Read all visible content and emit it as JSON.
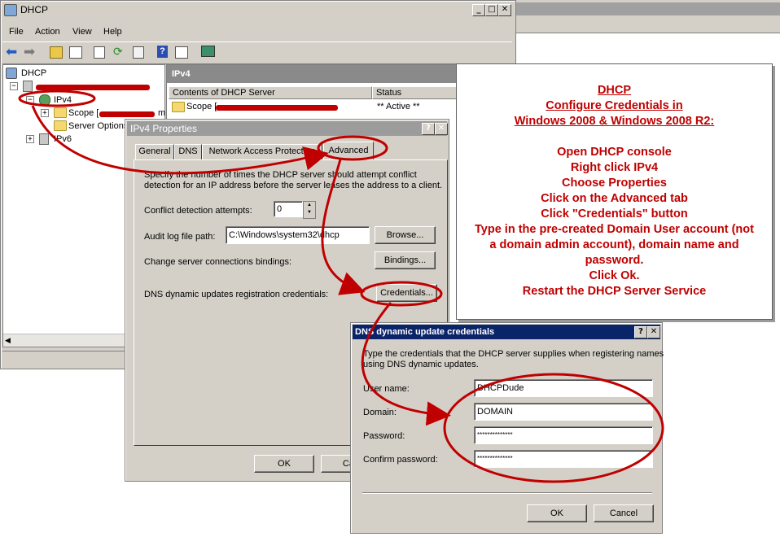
{
  "mmc": {
    "title": "DHCP",
    "menu": [
      "File",
      "Action",
      "View",
      "Help"
    ],
    "tree": {
      "root": "DHCP",
      "ipv4": "IPv4",
      "scope": "Scope [",
      "scope_suffix": "m",
      "server_options": "Server Options",
      "ipv6": "IPv6"
    },
    "right_header": "IPv4",
    "columns": {
      "contents": "Contents of DHCP Server",
      "status": "Status"
    },
    "rows": [
      {
        "name": "Scope [",
        "status": "** Active **"
      }
    ]
  },
  "props": {
    "title": "IPv4 Properties",
    "help_btn": "?",
    "close_btn": "✕",
    "tabs": [
      "General",
      "DNS",
      "Network Access Protection",
      "Advanced"
    ],
    "description": [
      "Specify the number of times the DHCP server should attempt conflict",
      "detection for an IP address before the server leases the address to a client."
    ],
    "conflict_label": "Conflict detection attempts:",
    "conflict_value": "0",
    "audit_label": "Audit log file path:",
    "audit_value": "C:\\Windows\\system32\\dhcp",
    "browse_btn": "Browse...",
    "bindings_label": "Change server connections bindings:",
    "bindings_btn": "Bindings...",
    "dns_label": "DNS dynamic updates registration credentials:",
    "credentials_btn": "Credentials...",
    "ok_btn": "OK",
    "cancel_btn": "Can"
  },
  "creds": {
    "title": "DNS dynamic update credentials",
    "help_btn": "?",
    "close_btn": "✕",
    "description": [
      "Type the credentials that the DHCP server supplies when registering names",
      "using DNS dynamic updates."
    ],
    "user_label": "User name:",
    "user_value": "DHCPDude",
    "domain_label": "Domain:",
    "domain_value": "DOMAIN",
    "password_label": "Password:",
    "password_value": "**************",
    "confirm_label": "Confirm password:",
    "confirm_value": "**************",
    "ok_btn": "OK",
    "cancel_btn": "Cancel"
  },
  "note": {
    "title": "DHCP",
    "subtitle1": "Configure Credentials in",
    "subtitle2": "Windows 2008 & Windows 2008 R2:",
    "steps": [
      "Open DHCP console",
      "Right click IPv4",
      "Choose Properties",
      "Click on the Advanced tab",
      "Click \"Credentials\" button",
      "Type in the pre-created Domain User account (not",
      "a domain admin account), domain name and",
      "password.",
      "Click Ok.",
      "Restart the DHCP Server Service"
    ]
  },
  "colors": {
    "annotation_red": "#c00000",
    "dialog_grey": "#d4d0c8",
    "titlebar_blue": "#0a246a"
  }
}
